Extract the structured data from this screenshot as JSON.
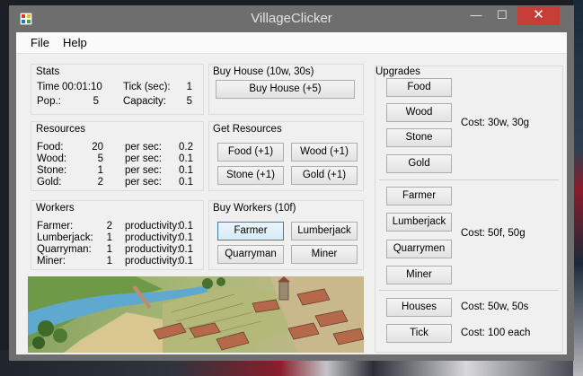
{
  "window": {
    "title": "VillageClicker",
    "minimize_glyph": "—",
    "maximize_glyph": "☐",
    "close_glyph": "✕"
  },
  "menu": {
    "file": "File",
    "help": "Help"
  },
  "stats": {
    "header": "Stats",
    "time_label": "Time",
    "time_value": "00:01:10",
    "tick_label": "Tick (sec):",
    "tick_value": "1",
    "pop_label": "Pop.:",
    "pop_value": "5",
    "capacity_label": "Capacity:",
    "capacity_value": "5"
  },
  "buy_house": {
    "header": "Buy House (10w, 30s)",
    "button": "Buy House (+5)"
  },
  "resources": {
    "header": "Resources",
    "rows": [
      {
        "name": "Food:",
        "amount": "20",
        "per_label": "per sec:",
        "rate": "0.2"
      },
      {
        "name": "Wood:",
        "amount": "5",
        "per_label": "per sec:",
        "rate": "0.1"
      },
      {
        "name": "Stone:",
        "amount": "1",
        "per_label": "per sec:",
        "rate": "0.1"
      },
      {
        "name": "Gold:",
        "amount": "2",
        "per_label": "per sec:",
        "rate": "0.1"
      }
    ]
  },
  "get_resources": {
    "header": "Get Resources",
    "food": "Food (+1)",
    "wood": "Wood (+1)",
    "stone": "Stone (+1)",
    "gold": "Gold (+1)"
  },
  "workers": {
    "header": "Workers",
    "rows": [
      {
        "name": "Farmer:",
        "count": "2",
        "prod_label": "productivity:",
        "prod": "0.1"
      },
      {
        "name": "Lumberjack:",
        "count": "1",
        "prod_label": "productivity:",
        "prod": "0.1"
      },
      {
        "name": "Quarryman:",
        "count": "1",
        "prod_label": "productivity:",
        "prod": "0.1"
      },
      {
        "name": "Miner:",
        "count": "1",
        "prod_label": "productivity:",
        "prod": "0.1"
      }
    ]
  },
  "buy_workers": {
    "header": "Buy Workers (10f)",
    "farmer": "Farmer",
    "lumberjack": "Lumberjack",
    "quarryman": "Quarryman",
    "miner": "Miner"
  },
  "upgrades": {
    "header": "Upgrades",
    "food": "Food",
    "wood": "Wood",
    "stone": "Stone",
    "gold": "Gold",
    "resources_cost": "Cost: 30w, 30g",
    "farmer": "Farmer",
    "lumberjack": "Lumberjack",
    "quarrymen": "Quarrymen",
    "miner": "Miner",
    "workers_cost": "Cost: 50f, 50g",
    "houses": "Houses",
    "houses_cost": "Cost: 50w, 50s",
    "tick": "Tick",
    "tick_cost": "Cost: 100 each"
  }
}
